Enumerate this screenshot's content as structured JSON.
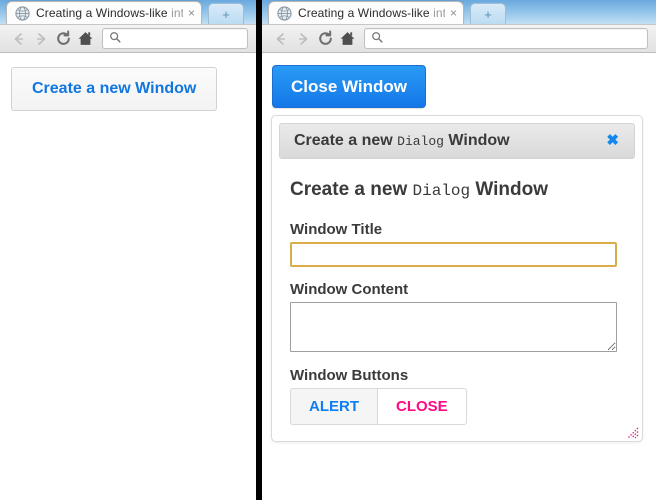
{
  "left_window": {
    "tab": {
      "favicon": "globe-icon",
      "title_main": "Creating a Windows-like ",
      "title_faded": "int",
      "close": "×"
    },
    "new_tab_label": "+",
    "toolbar": {
      "back": "←",
      "forward": "→",
      "reload": "⟳",
      "home": "⌂",
      "omnibox_value": "",
      "omnibox_placeholder": "",
      "search_icon": "magnifier-icon"
    },
    "page": {
      "create_button": "Create a new Window"
    }
  },
  "right_window": {
    "tab": {
      "favicon": "globe-icon",
      "title_main": "Creating a Windows-like ",
      "title_faded": "int",
      "close": "×"
    },
    "new_tab_label": "+",
    "toolbar": {
      "back": "←",
      "forward": "→",
      "reload": "⟳",
      "home": "⌂",
      "omnibox_value": "",
      "omnibox_placeholder": "",
      "search_icon": "magnifier-icon"
    },
    "page": {
      "close_button": "Close Window",
      "dialog": {
        "titlebar": {
          "text_before": "Create a new ",
          "text_mono": "Dialog",
          "text_after": " Window",
          "close_glyph": "✖"
        },
        "heading": {
          "text_before": "Create a new ",
          "text_mono": "Dialog",
          "text_after": " Window"
        },
        "fields": [
          {
            "label": "Window Title",
            "type": "text",
            "value": "",
            "placeholder": "",
            "focused": true
          },
          {
            "label": "Window Content",
            "type": "textarea",
            "value": "",
            "placeholder": "",
            "focused": false
          }
        ],
        "buttons_label": "Window Buttons",
        "buttons": [
          {
            "label": "ALERT",
            "color": "#0d7ef5"
          },
          {
            "label": "CLOSE",
            "color": "#ff0a80"
          }
        ],
        "resize_grip": "resize-grip-icon"
      }
    }
  },
  "colors": {
    "accent_blue": "#1177e0",
    "primary_button": "#1477e8",
    "alert_text": "#0d7ef5",
    "close_text": "#ff0a80",
    "focus_border": "#d8ad4a",
    "grip": "#e0248c"
  }
}
